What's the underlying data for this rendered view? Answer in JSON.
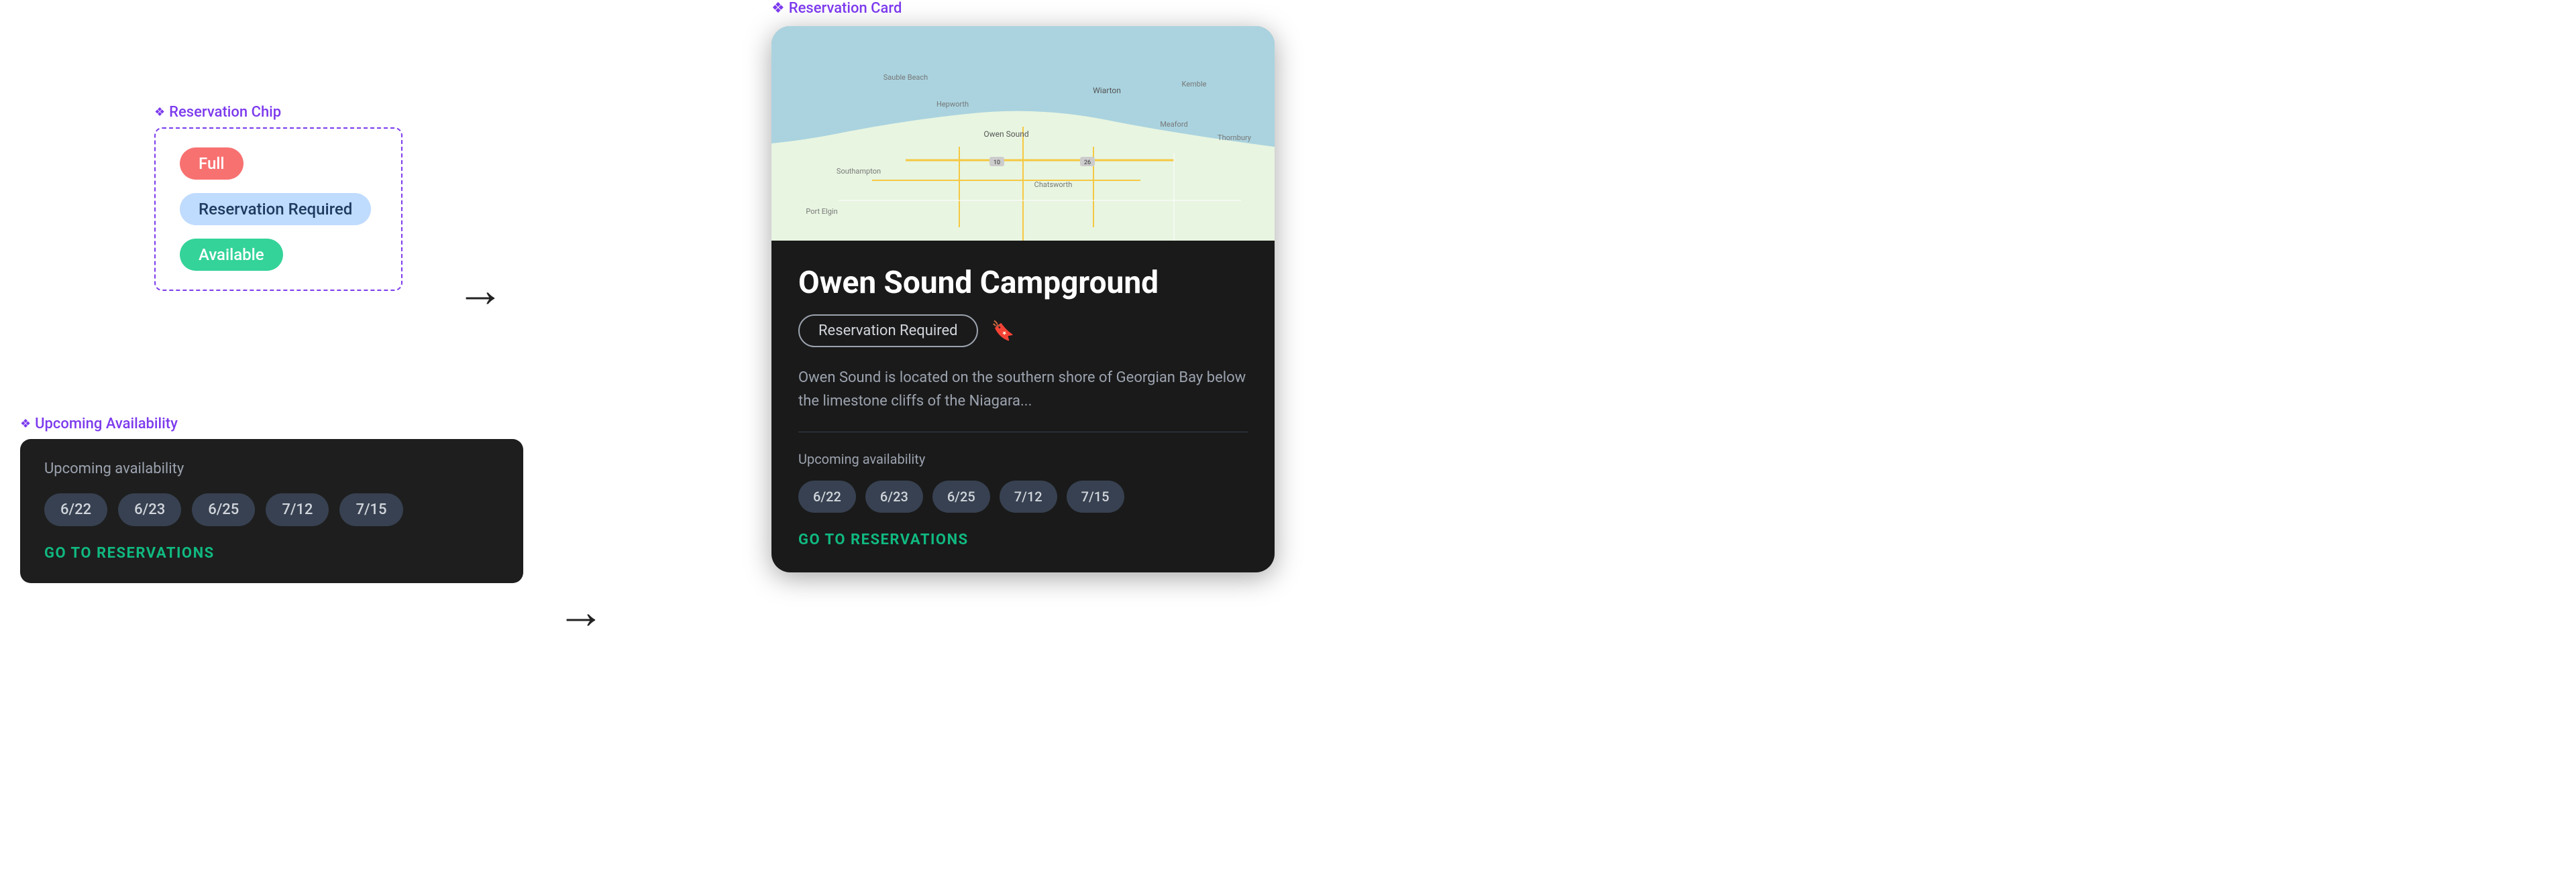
{
  "chip_section": {
    "label": "Reservation Chip",
    "diamond": "❖",
    "chips": [
      {
        "text": "Full",
        "type": "full"
      },
      {
        "text": "Reservation Required",
        "type": "reservation"
      },
      {
        "text": "Available",
        "type": "available"
      }
    ]
  },
  "upcoming_section": {
    "label": "Upcoming Availability",
    "diamond": "❖",
    "box": {
      "upcoming_label": "Upcoming availability",
      "dates": [
        "6/22",
        "6/23",
        "6/25",
        "7/12",
        "7/15"
      ],
      "go_label": "GO TO RESERVATIONS"
    }
  },
  "card_section": {
    "label": "Reservation Card",
    "diamond": "❖",
    "card": {
      "name": "Owen Sound Campground",
      "chip_text": "Reservation Required",
      "bookmark_icon": "🔖",
      "description": "Owen Sound is located on the southern shore of Georgian Bay below the limestone cliffs of the Niagara...",
      "upcoming_label": "Upcoming availability",
      "dates": [
        "6/22",
        "6/23",
        "6/25",
        "7/12",
        "7/15"
      ],
      "go_label": "GO TO RESERVATIONS"
    }
  },
  "arrow_label": "→"
}
